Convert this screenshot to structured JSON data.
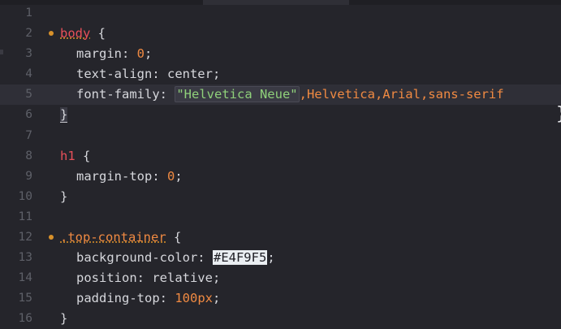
{
  "editor": {
    "theme_colors": {
      "background": "#25252b",
      "selector": "#e8505a",
      "number": "#f08a42",
      "string": "#8fd07a",
      "modified_dot": "#d8912a"
    },
    "lines": [
      {
        "num": "1"
      },
      {
        "num": "2",
        "modified": true,
        "selector": "body",
        "open": " {"
      },
      {
        "num": "3",
        "prop": "margin: ",
        "value": "0",
        "end": ";"
      },
      {
        "num": "4",
        "prop": "text-align: center;"
      },
      {
        "num": "5",
        "prop": "font-family: ",
        "string": "\"Helvetica Neue\"",
        "rest": ",Helvetica,Arial,sans-serif"
      },
      {
        "num": "6",
        "close": "}"
      },
      {
        "num": "7"
      },
      {
        "num": "8",
        "selector": "h1",
        "open": " {"
      },
      {
        "num": "9",
        "prop": "margin-top: ",
        "value": "0",
        "end": ";"
      },
      {
        "num": "10",
        "close": "}"
      },
      {
        "num": "11"
      },
      {
        "num": "12",
        "modified": true,
        "selector": ".top-container",
        "open": " {"
      },
      {
        "num": "13",
        "prop": "background-color: ",
        "hex": "#E4F9F5",
        "end": ";"
      },
      {
        "num": "14",
        "prop": "position: relative;"
      },
      {
        "num": "15",
        "prop": "padding-top: ",
        "value": "100px",
        "end": ";"
      },
      {
        "num": "16",
        "close": "}"
      }
    ],
    "overflow_brace": "}"
  }
}
